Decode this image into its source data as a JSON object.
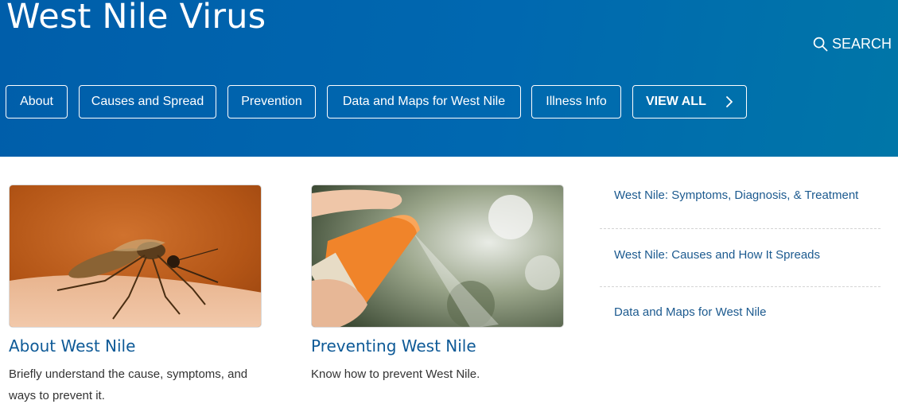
{
  "header": {
    "title": "West Nile Virus",
    "search_label": "SEARCH"
  },
  "nav": {
    "items": [
      {
        "label": "About"
      },
      {
        "label": "Causes and Spread"
      },
      {
        "label": "Prevention"
      },
      {
        "label": "Data and Maps for West Nile"
      },
      {
        "label": "Illness Info"
      }
    ],
    "view_all_label": "VIEW ALL"
  },
  "cards": [
    {
      "title": "About West Nile",
      "description": "Briefly understand the cause, symptoms, and ways to prevent it.",
      "image_icon": "mosquito-photo"
    },
    {
      "title": "Preventing West Nile",
      "description": "Know how to prevent West Nile.",
      "image_icon": "insect-repellent-spray-photo"
    }
  ],
  "side_links": [
    {
      "label": "West Nile: Symptoms, Diagnosis, & Treatment"
    },
    {
      "label": "West Nile: Causes and How It Spreads"
    },
    {
      "label": "Data and Maps for West Nile"
    }
  ],
  "colors": {
    "hero_start": "#005eaa",
    "hero_end": "#0076a8",
    "link": "#1c5a8f",
    "card_title": "#0e5a97"
  }
}
